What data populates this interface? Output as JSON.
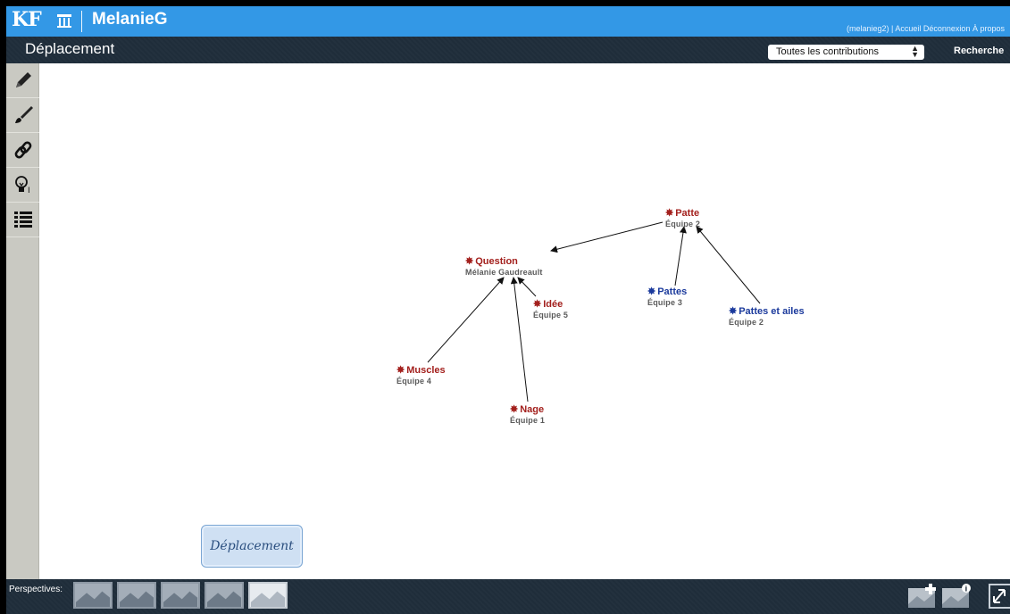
{
  "header": {
    "logo": "KF",
    "user_title": "MelanieG",
    "links": {
      "user": "(melanieg2)",
      "separator": "|",
      "home": "Accueil",
      "logout": "Déconnexion",
      "about": "À propos"
    }
  },
  "subbar": {
    "view_title": "Déplacement",
    "filter_select": "Toutes les contributions",
    "search": "Recherche"
  },
  "toolbar": {
    "tools": [
      "pencil-icon",
      "brush-icon",
      "link-icon",
      "lightbulb-icon",
      "list-icon"
    ]
  },
  "notes": [
    {
      "title": "Patte",
      "author": "Équipe 2",
      "color": "red"
    },
    {
      "title": "Question",
      "author": "Mélanie Gaudreault",
      "color": "red"
    },
    {
      "title": "Idée",
      "author": "Équipe 5",
      "color": "red"
    },
    {
      "title": "Pattes",
      "author": "Équipe 3",
      "color": "blue"
    },
    {
      "title": "Pattes et ailes",
      "author": "Équipe 2",
      "color": "blue"
    },
    {
      "title": "Muscles",
      "author": "Équipe 4",
      "color": "red"
    },
    {
      "title": "Nage",
      "author": "Équipe 1",
      "color": "red"
    }
  ],
  "view_card": {
    "label": "Déplacement"
  },
  "bottom": {
    "perspectives_label": "Perspectives:"
  },
  "colors": {
    "topbar": "#3398e6",
    "darkbar": "#1f2d3a",
    "note_red": "#a3201d",
    "note_blue": "#1b3a9c"
  }
}
